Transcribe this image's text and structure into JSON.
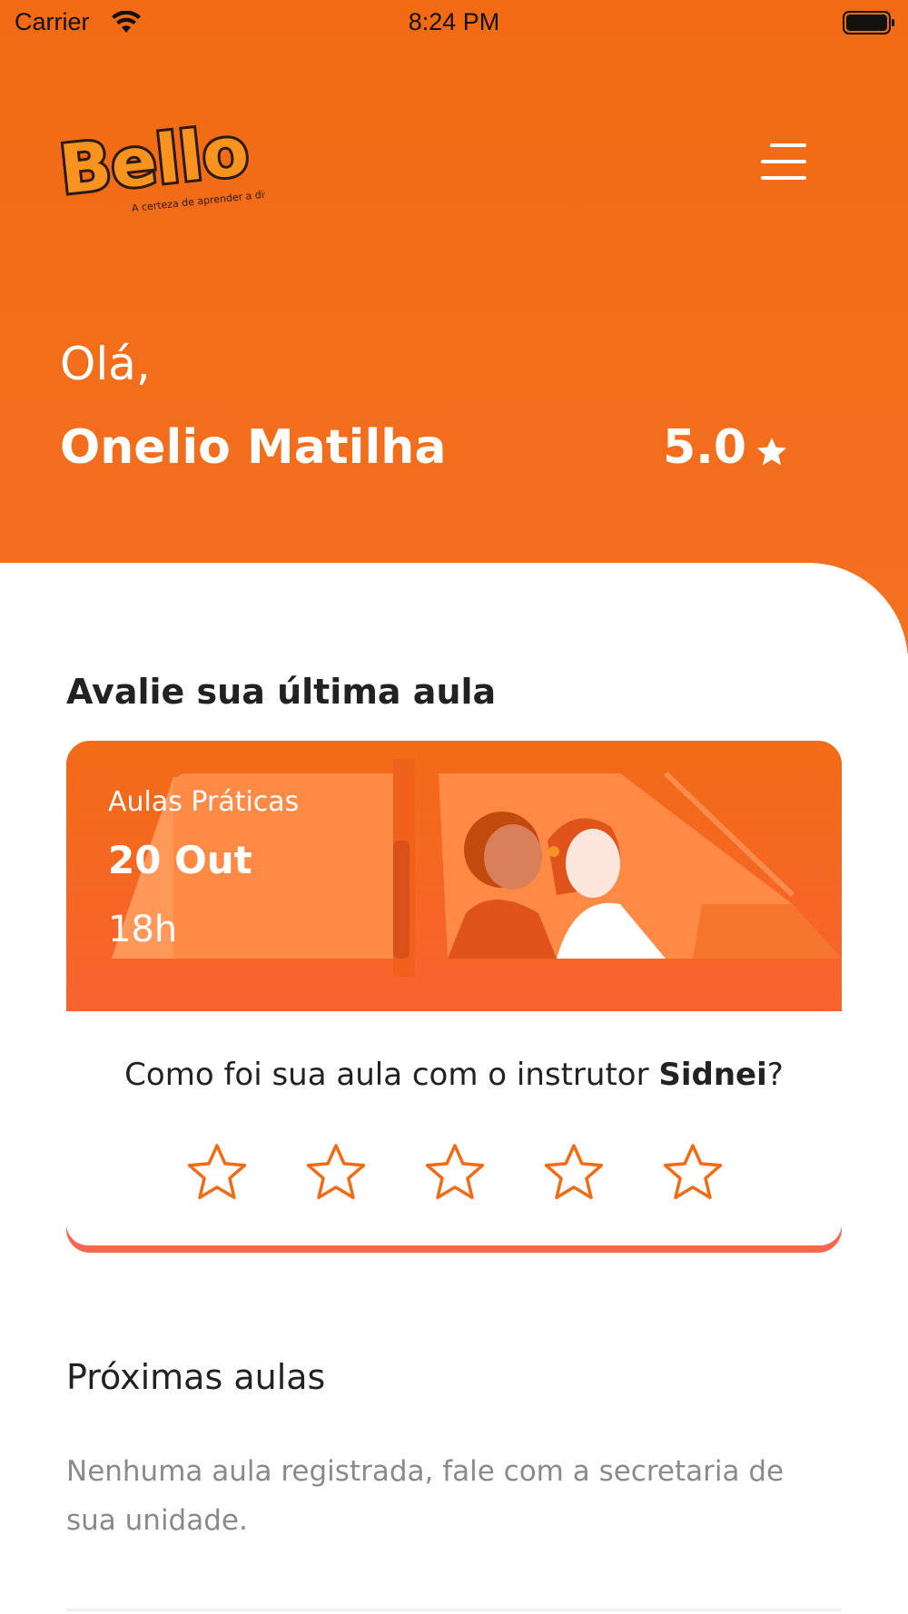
{
  "status_bar": {
    "carrier": "Carrier",
    "time": "8:24 PM"
  },
  "header": {
    "logo_text": "Bello",
    "logo_tagline": "A certeza de aprender a dirigir",
    "menu_icon": "hamburger-menu-icon",
    "greeting": "Olá,",
    "user_name": "Onelio Matilha",
    "rating": "5.0",
    "rating_icon": "star-filled-icon"
  },
  "review": {
    "title": "Avalie sua última aula",
    "lesson_type": "Aulas Práticas",
    "lesson_date": "20 Out",
    "lesson_time": "18h",
    "question_prefix": "Como foi sua aula com o instrutor ",
    "instructor": "Sidnei",
    "question_suffix": "?",
    "stars_count": 5,
    "selected_stars": 0,
    "star_icon": "star-outline-icon"
  },
  "upcoming": {
    "title": "Próximas aulas",
    "empty_message": "Nenhuma aula registrada, fale com a secretaria de sua unidade."
  },
  "colors": {
    "primary": "#F26B14",
    "accent_red": "#F9654D",
    "text_dark": "#222222",
    "text_muted": "#8A8A8A"
  }
}
